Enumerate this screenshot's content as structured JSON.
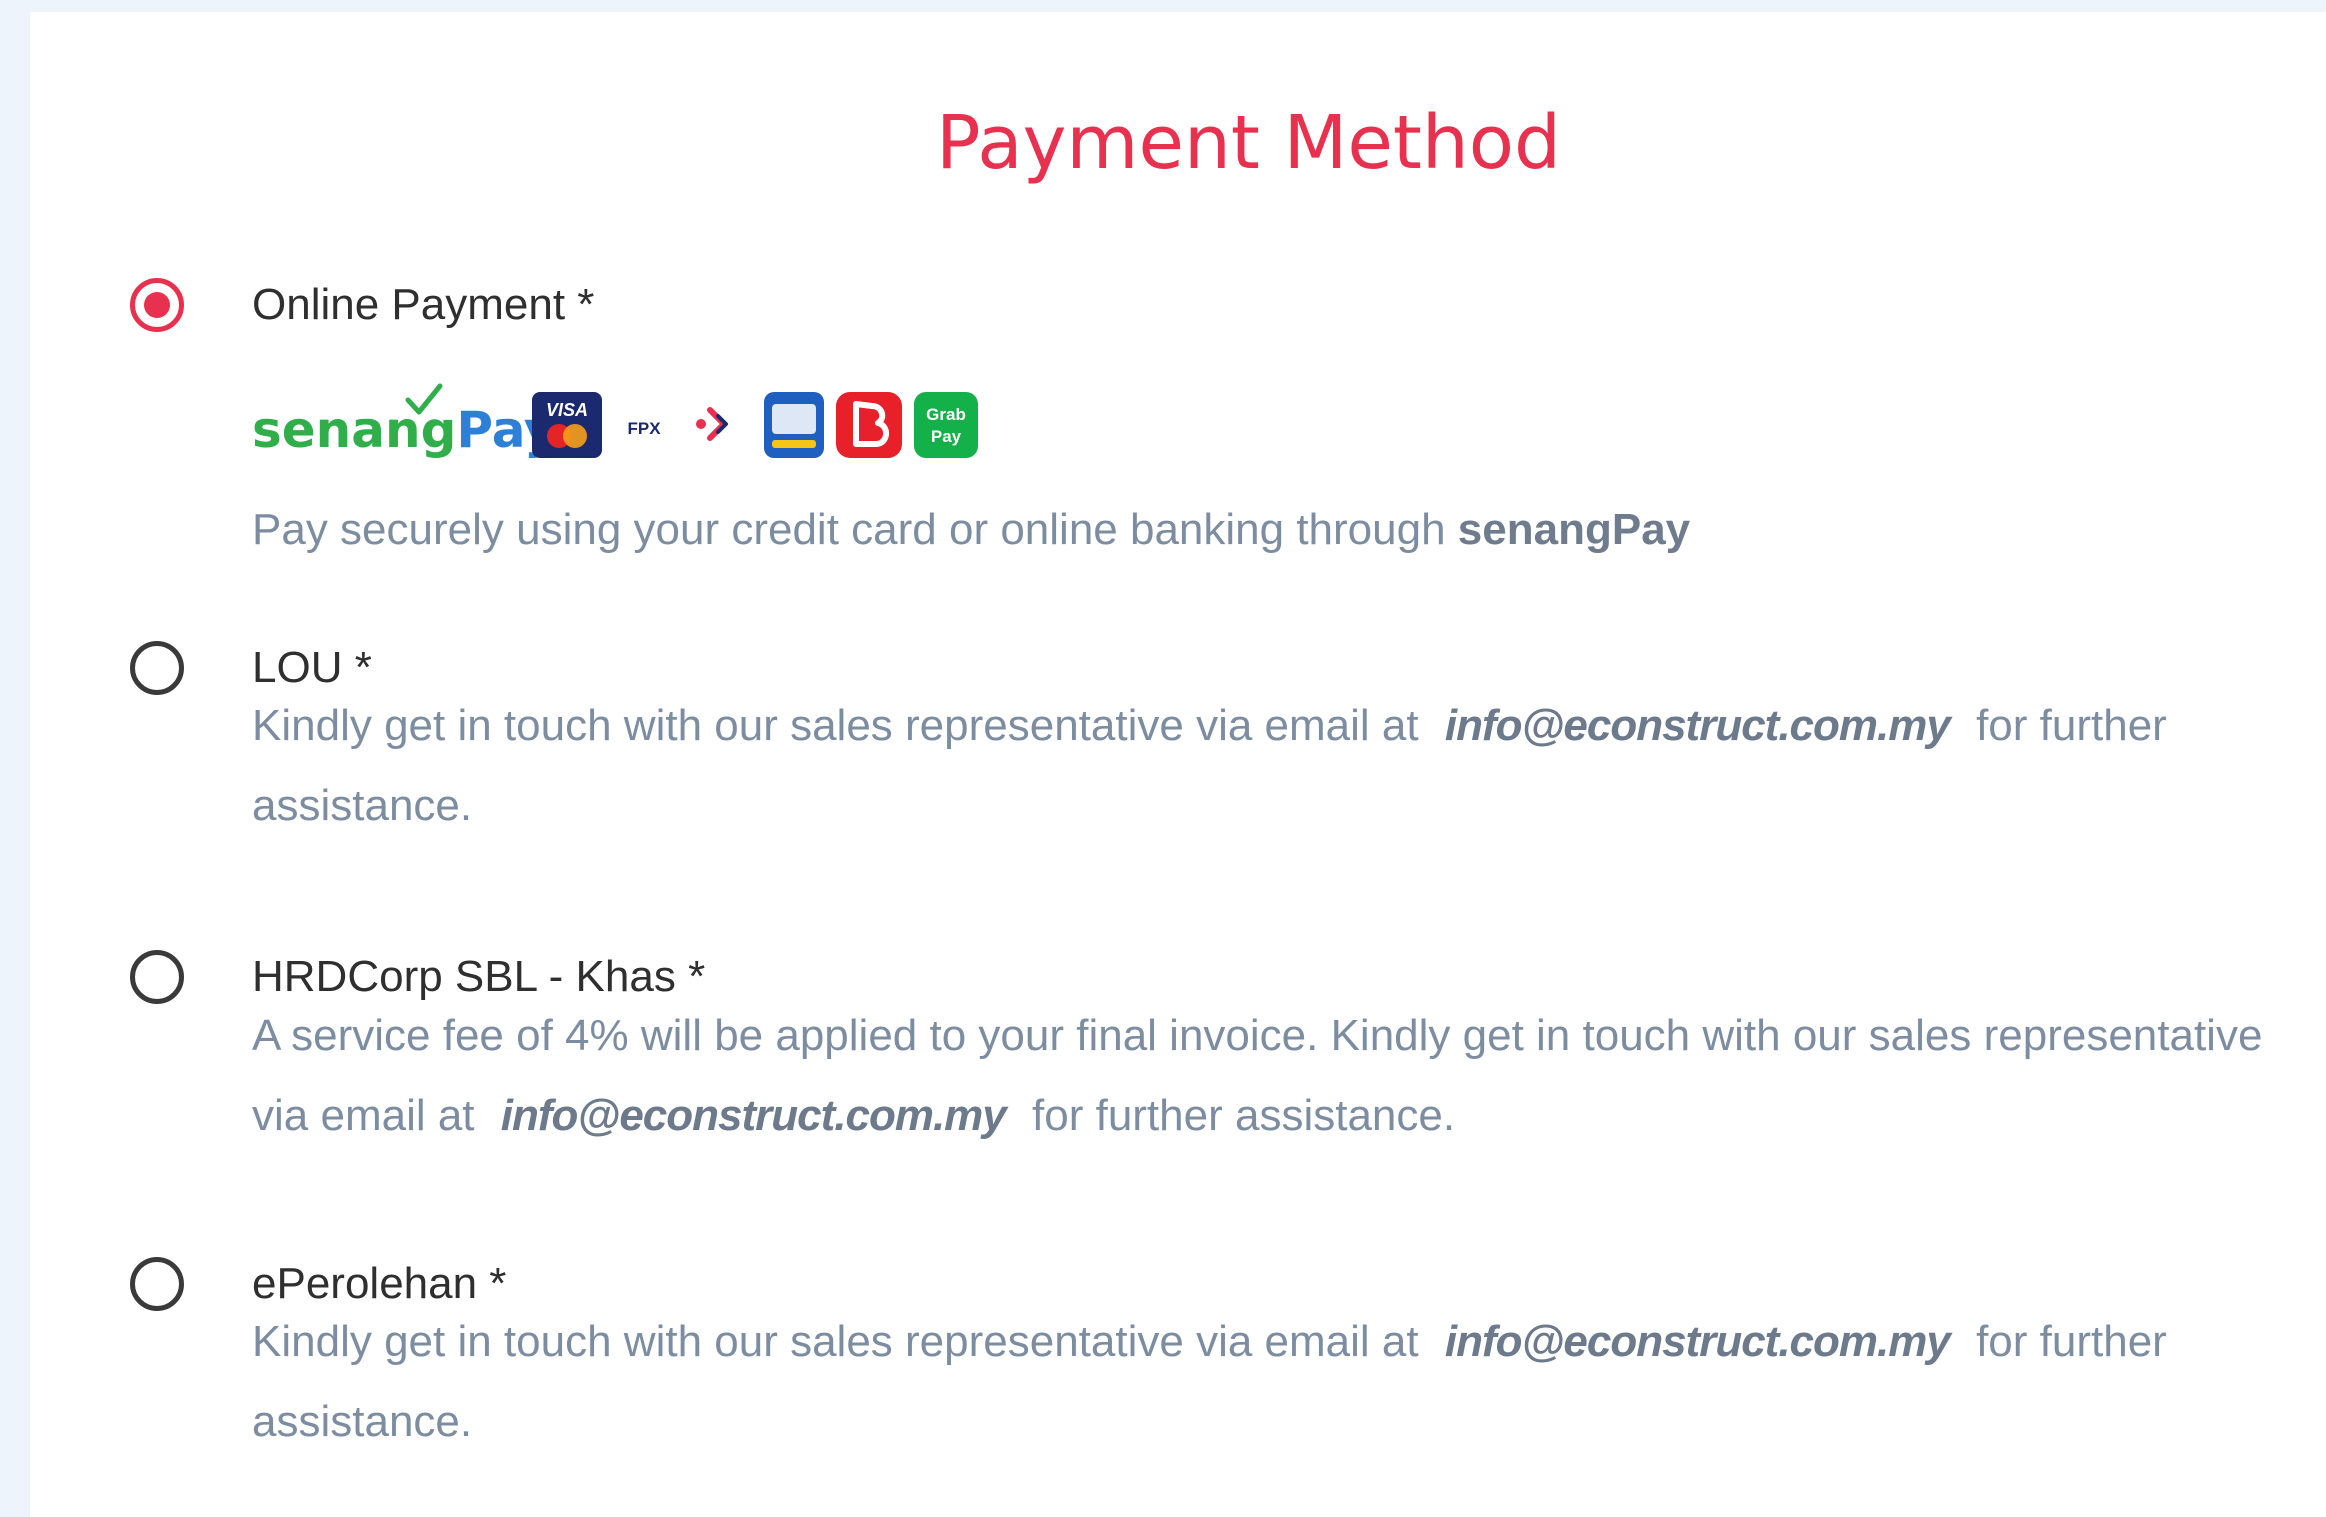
{
  "header": {
    "title": "Payment Method"
  },
  "options": [
    {
      "label": "Online Payment *",
      "selected": true,
      "provider_logo": {
        "text_part1": "senang",
        "text_part2": "Pay"
      },
      "payment_icons": [
        "visa-mastercard-icon",
        "fpx-icon",
        "duitnow-icon",
        "touch-n-go-icon",
        "boost-icon",
        "grabpay-icon"
      ],
      "icon_texts": {
        "fpx": "FPX",
        "grab_line1": "Grab",
        "grab_line2": "Pay"
      },
      "description_prefix": "Pay securely using your credit card or online banking through ",
      "description_bold": "senangPay"
    },
    {
      "label": "LOU *",
      "selected": false,
      "description_prefix": "Kindly get in touch with our sales representative via email at",
      "email": "info@econstruct.com.my",
      "description_suffix": "for further assistance."
    },
    {
      "label": "HRDCorp SBL - Khas *",
      "selected": false,
      "description_prefix": "A service fee of 4% will be applied to your final invoice. Kindly get in touch with our sales representative via email at",
      "email": "info@econstruct.com.my",
      "description_suffix": "for further assistance."
    },
    {
      "label": "ePerolehan *",
      "selected": false,
      "description_prefix": "Kindly get in touch with our sales representative via email at",
      "email": "info@econstruct.com.my",
      "description_suffix": "for further assistance."
    }
  ],
  "colors": {
    "accent": "#e8304f",
    "description_text": "#7d8da1",
    "label_text": "#2f2f2f",
    "background": "#edf4fb"
  }
}
